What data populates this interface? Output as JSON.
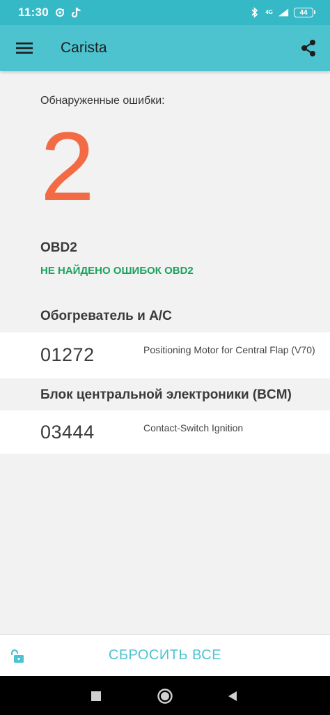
{
  "status_bar": {
    "time": "11:30",
    "network_label": "4G",
    "battery_level": "44",
    "icons": [
      "sync-icon",
      "tiktok-icon",
      "bluetooth-icon",
      "signal-icon",
      "battery-icon"
    ]
  },
  "app_bar": {
    "title": "Carista",
    "icons": [
      "menu-icon",
      "share-icon"
    ]
  },
  "summary": {
    "label": "Обнаруженные ошибки:",
    "count": "2"
  },
  "sections": [
    {
      "title": "OBD2",
      "status": "НЕ НАЙДЕНО ОШИБОК OBD2"
    },
    {
      "title": "Обогреватель и A/C",
      "codes": [
        {
          "code": "01272",
          "description": "Positioning Motor for Central Flap (V70)"
        }
      ]
    },
    {
      "title": "Блок центральной электроники (BCM)",
      "codes": [
        {
          "code": "03444",
          "description": "Contact-Switch Ignition"
        }
      ]
    }
  ],
  "bottom_bar": {
    "reset_label": "СБРОСИТЬ ВСЕ",
    "icons": [
      "unlock-icon"
    ]
  },
  "nav_bar": {
    "icons": [
      "recents-icon",
      "home-icon",
      "back-icon"
    ]
  },
  "colors": {
    "status_bar": "#36b9c7",
    "app_bar": "#4ec3d0",
    "error_count": "#f26b45",
    "success": "#1aa35c",
    "accent": "#4ec3d0"
  }
}
